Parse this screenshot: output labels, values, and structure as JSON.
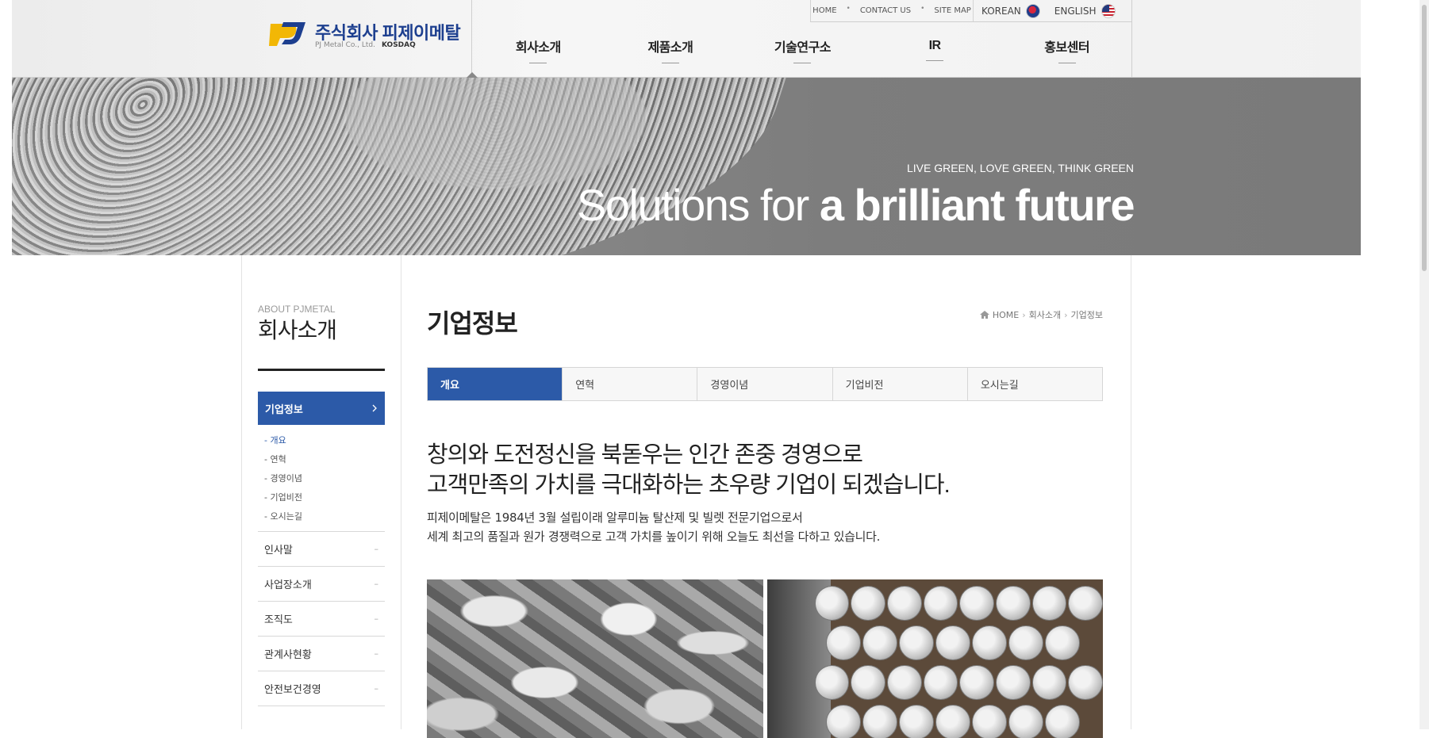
{
  "header": {
    "logo_name": "주식회사 피제이메탈",
    "logo_sub": "PJ Metal Co., Ltd.",
    "logo_market": "KOSDAQ",
    "util_links": [
      "HOME",
      "CONTACT US",
      "SITE MAP"
    ],
    "languages": [
      {
        "label": "KOREAN",
        "flag": "kr-flag-icon"
      },
      {
        "label": "ENGLISH",
        "flag": "us-flag-icon"
      }
    ],
    "nav": [
      "회사소개",
      "제품소개",
      "기술연구소",
      "IR",
      "홍보센터"
    ]
  },
  "hero": {
    "tagline": "LIVE GREEN, LOVE GREEN, THINK GREEN",
    "title_light": "Solutions for ",
    "title_bold": "a brilliant future"
  },
  "sidebar": {
    "eyebrow": "ABOUT PJMETAL",
    "title": "회사소개",
    "active": {
      "label": "기업정보",
      "icon": "chevron-right-icon"
    },
    "sub_items": [
      "- 개요",
      "- 연혁",
      "- 경영이념",
      "- 기업비전",
      "- 오시는길"
    ],
    "items": [
      "인사말",
      "사업장소개",
      "조직도",
      "관계사현황",
      "안전보건경영"
    ],
    "item_marker": "–"
  },
  "main": {
    "page_title": "기업정보",
    "breadcrumb": [
      "HOME",
      "회사소개",
      "기업정보"
    ],
    "tabs": [
      "개요",
      "연혁",
      "경영이념",
      "기업비전",
      "오시는길"
    ],
    "headline_1": "창의와 도전정신을 북돋우는 인간 존중 경영으로",
    "headline_2": "고객만족의 가치를 극대화하는 초우량 기업이 되겠습니다.",
    "intro_1": "피제이메탈은 1984년 3월 설립이래 알루미늄 탈산제 및 빌렛 전문기업으로서",
    "intro_2": "세계 최고의 품질과 원가 경쟁력으로 고객 가치를 높이기 위해 오늘도 최선을 다하고 있습니다."
  },
  "colors": {
    "brand_blue": "#2c5aa8",
    "logo_navy": "#1d3f8f",
    "logo_gold": "#f2b705"
  }
}
